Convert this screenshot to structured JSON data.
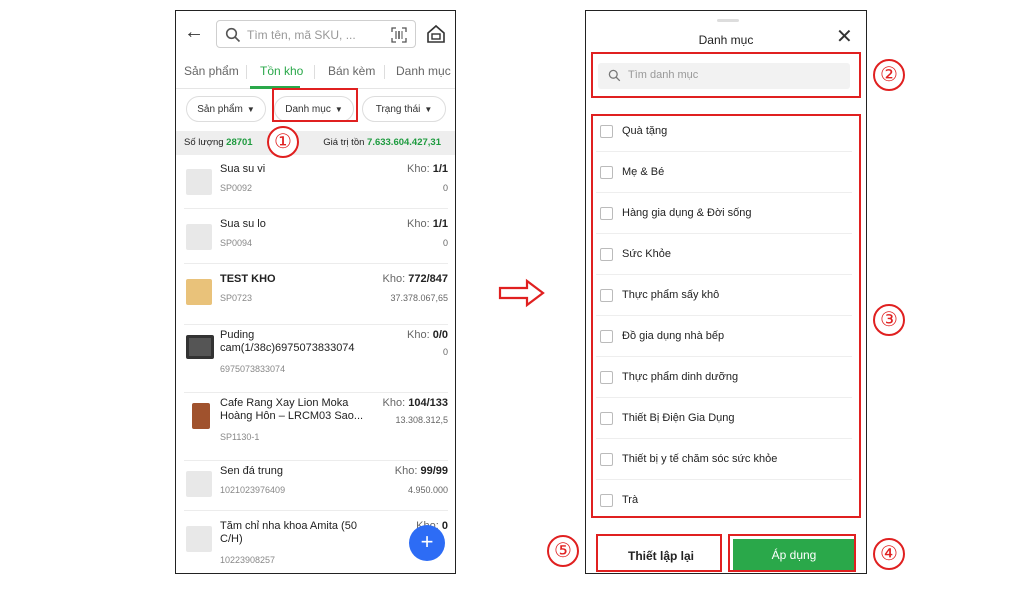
{
  "left_screen": {
    "search": {
      "placeholder": "Tìm tên, mã SKU, ..."
    },
    "tabs": [
      {
        "label": "Sản phẩm",
        "active": false
      },
      {
        "label": "Tồn kho",
        "active": true
      },
      {
        "label": "Bán kèm",
        "active": false
      },
      {
        "label": "Danh mục",
        "active": false
      }
    ],
    "filters": [
      {
        "label": "Sản phẩm"
      },
      {
        "label": "Danh mục"
      },
      {
        "label": "Trạng thái"
      }
    ],
    "summary": {
      "qty_label": "Số lượng",
      "qty_value": "28701",
      "value_label": "Giá trị tồn",
      "value_value": "7.633.604.427,31"
    },
    "stock_prefix": "Kho:",
    "products": [
      {
        "name": "Sua su vi",
        "sku": "SP0092",
        "stock": "1/1",
        "amount": "0",
        "thumb": "placeholder-icon"
      },
      {
        "name": "Sua su lo",
        "sku": "SP0094",
        "stock": "1/1",
        "amount": "0",
        "thumb": "placeholder-icon"
      },
      {
        "name": "TEST KHO",
        "sku": "SP0723",
        "stock": "772/847",
        "amount": "37.378.067,65",
        "thumb": "box-image"
      },
      {
        "name": "Puding cam(1/38c)6975073833074",
        "sku": "6975073833074",
        "stock": "0/0",
        "amount": "0",
        "thumb": "pudding-image"
      },
      {
        "name": "Cafe Rang Xay Lion Moka Hoàng Hôn – LRCM03 Sao...",
        "sku": "SP1130-1",
        "stock": "104/133",
        "amount": "13.308.312,5",
        "thumb": "coffee-image"
      },
      {
        "name": "Sen đá trung",
        "sku": "1021023976409",
        "stock": "99/99",
        "amount": "4.950.000",
        "thumb": "placeholder-icon"
      },
      {
        "name": "Tăm chỉ nha khoa Amita (50 C/H)",
        "sku": "10223908257",
        "stock": "0",
        "amount": "3",
        "thumb": "placeholder-icon"
      }
    ],
    "fab_label": "+"
  },
  "right_screen": {
    "title": "Danh mục",
    "search_placeholder": "Tìm danh mục",
    "categories": [
      {
        "label": "Quà tặng",
        "checked": false
      },
      {
        "label": "Mẹ & Bé",
        "checked": false
      },
      {
        "label": "Hàng gia dụng & Đời sống",
        "checked": false
      },
      {
        "label": "Sức Khỏe",
        "checked": false
      },
      {
        "label": "Thực phẩm sấy khô",
        "checked": false
      },
      {
        "label": "Đồ gia dụng nhà bếp",
        "checked": false
      },
      {
        "label": "Thực phẩm dinh dưỡng",
        "checked": false
      },
      {
        "label": "Thiết Bị Điện Gia Dụng",
        "checked": false
      },
      {
        "label": "Thiết bị y tế chăm sóc sức khỏe",
        "checked": false
      },
      {
        "label": "Trà",
        "checked": false
      }
    ],
    "reset_label": "Thiết lập lại",
    "apply_label": "Áp dụng"
  },
  "annotations": [
    "①",
    "②",
    "③",
    "④",
    "⑤"
  ],
  "colors": {
    "accent": "#2aa84a",
    "annotation": "#e02020",
    "fab": "#2d6cf5"
  }
}
